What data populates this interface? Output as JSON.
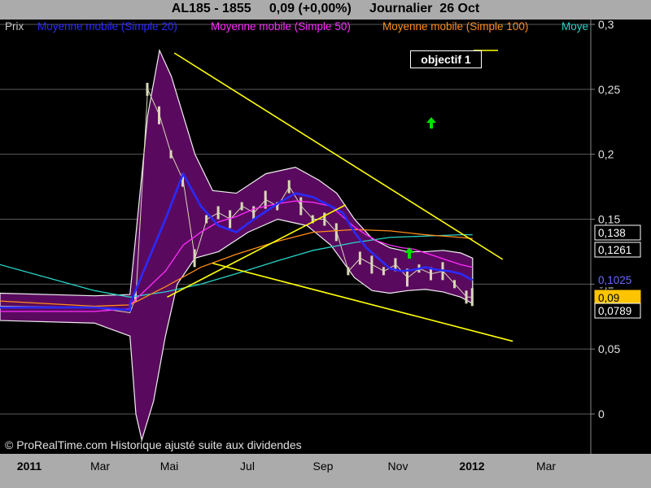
{
  "header": {
    "title": "AL185 - 1855     0,09 (+0,00%)     Journalier  26 Oct"
  },
  "legend": [
    {
      "label": "Prix",
      "color": "#c8c8c8"
    },
    {
      "label": "Moyenne mobile (Simple 20)",
      "color": "#2a2aff"
    },
    {
      "label": "Moyenne mobile (Simple 50)",
      "color": "#ff2dff"
    },
    {
      "label": "Moyenne mobile (Simple 100)",
      "color": "#ff8c1a"
    },
    {
      "label": "Moye",
      "color": "#29d3c8"
    }
  ],
  "annotation": {
    "label": "objectif 1"
  },
  "copyright": "© ProRealTime.com Historique ajusté suite aux dividendes",
  "chart_data": {
    "type": "line",
    "x_tick_labels": [
      "2011",
      "Mar",
      "Mai",
      "Jul",
      "Sep",
      "Nov",
      "2012",
      "Mar"
    ],
    "y_tick_labels": [
      "0,3",
      "0,25",
      "0,2",
      "0,15",
      "0,1",
      "0,05",
      "0"
    ],
    "y_ticks": [
      0.3,
      0.25,
      0.2,
      0.15,
      0.1,
      0.05,
      0
    ],
    "ylim": [
      -0.02,
      0.31
    ],
    "grid": true,
    "price_tags": [
      {
        "label": "0,138",
        "value": 0.138,
        "bg": "#000000",
        "fg": "#ffffff",
        "border": "#ffffff"
      },
      {
        "label": "0,1261",
        "value": 0.1261,
        "bg": "#000000",
        "fg": "#ffffff",
        "border": "#ffffff"
      },
      {
        "label": "0,1025",
        "value": 0.1025,
        "bg": "#000000",
        "fg": "#6a6aff",
        "border": "#000000"
      },
      {
        "label": "0,09",
        "value": 0.09,
        "bg": "#ffc400",
        "fg": "#000000",
        "border": "#ffc400"
      },
      {
        "label": "0,0789",
        "value": 0.0789,
        "bg": "#000000",
        "fg": "#ffffff",
        "border": "#ffffff"
      }
    ],
    "series": [
      {
        "name": "Moyenne mobile (Simple 20)",
        "color": "#2a2aff",
        "points": [
          [
            0,
            0.082
          ],
          [
            0.16,
            0.082
          ],
          [
            0.22,
            0.08
          ],
          [
            0.22,
            0.085
          ],
          [
            0.28,
            0.15
          ],
          [
            0.31,
            0.185
          ],
          [
            0.34,
            0.16
          ],
          [
            0.37,
            0.145
          ],
          [
            0.4,
            0.14
          ],
          [
            0.43,
            0.15
          ],
          [
            0.47,
            0.162
          ],
          [
            0.5,
            0.17
          ],
          [
            0.53,
            0.167
          ],
          [
            0.56,
            0.16
          ],
          [
            0.58,
            0.155
          ],
          [
            0.6,
            0.14
          ],
          [
            0.62,
            0.128
          ],
          [
            0.64,
            0.12
          ],
          [
            0.66,
            0.112
          ],
          [
            0.68,
            0.11
          ],
          [
            0.7,
            0.111
          ],
          [
            0.72,
            0.113
          ],
          [
            0.74,
            0.111
          ],
          [
            0.76,
            0.11
          ],
          [
            0.78,
            0.108
          ],
          [
            0.8,
            0.103
          ]
        ]
      },
      {
        "name": "Moyenne mobile (Simple 50)",
        "color": "#ff2dff",
        "points": [
          [
            0,
            0.079
          ],
          [
            0.16,
            0.079
          ],
          [
            0.22,
            0.081
          ],
          [
            0.22,
            0.084
          ],
          [
            0.28,
            0.11
          ],
          [
            0.31,
            0.13
          ],
          [
            0.34,
            0.14
          ],
          [
            0.37,
            0.148
          ],
          [
            0.4,
            0.152
          ],
          [
            0.43,
            0.158
          ],
          [
            0.47,
            0.162
          ],
          [
            0.5,
            0.164
          ],
          [
            0.53,
            0.163
          ],
          [
            0.56,
            0.16
          ],
          [
            0.58,
            0.152
          ],
          [
            0.6,
            0.144
          ],
          [
            0.62,
            0.138
          ],
          [
            0.64,
            0.133
          ],
          [
            0.66,
            0.13
          ],
          [
            0.68,
            0.128
          ],
          [
            0.7,
            0.127
          ],
          [
            0.72,
            0.124
          ],
          [
            0.74,
            0.121
          ],
          [
            0.76,
            0.118
          ],
          [
            0.78,
            0.115
          ],
          [
            0.8,
            0.113
          ]
        ]
      },
      {
        "name": "Moyenne mobile (Simple 100)",
        "color": "#ff8c1a",
        "points": [
          [
            0,
            0.087
          ],
          [
            0.16,
            0.083
          ],
          [
            0.22,
            0.084
          ],
          [
            0.28,
            0.098
          ],
          [
            0.34,
            0.113
          ],
          [
            0.4,
            0.123
          ],
          [
            0.47,
            0.133
          ],
          [
            0.53,
            0.14
          ],
          [
            0.6,
            0.142
          ],
          [
            0.66,
            0.141
          ],
          [
            0.72,
            0.138
          ],
          [
            0.78,
            0.136
          ],
          [
            0.8,
            0.135
          ]
        ]
      },
      {
        "name": "Moye",
        "color": "#29d3c8",
        "points": [
          [
            0,
            0.115
          ],
          [
            0.08,
            0.105
          ],
          [
            0.16,
            0.095
          ],
          [
            0.22,
            0.09
          ],
          [
            0.28,
            0.094
          ],
          [
            0.34,
            0.1
          ],
          [
            0.4,
            0.108
          ],
          [
            0.47,
            0.118
          ],
          [
            0.53,
            0.126
          ],
          [
            0.6,
            0.132
          ],
          [
            0.66,
            0.136
          ],
          [
            0.72,
            0.137
          ],
          [
            0.78,
            0.138
          ],
          [
            0.8,
            0.138
          ]
        ]
      }
    ],
    "price": {
      "name": "Prix",
      "color": "#d8d8b8",
      "points": [
        [
          0,
          0.083
        ],
        [
          0.16,
          0.082
        ],
        [
          0.22,
          0.078
        ],
        [
          0.23,
          0.09
        ],
        [
          0.25,
          0.25
        ],
        [
          0.27,
          0.23
        ],
        [
          0.29,
          0.2
        ],
        [
          0.31,
          0.18
        ],
        [
          0.33,
          0.12
        ],
        [
          0.35,
          0.15
        ],
        [
          0.37,
          0.155
        ],
        [
          0.39,
          0.15
        ],
        [
          0.41,
          0.16
        ],
        [
          0.43,
          0.155
        ],
        [
          0.45,
          0.165
        ],
        [
          0.47,
          0.16
        ],
        [
          0.49,
          0.175
        ],
        [
          0.51,
          0.16
        ],
        [
          0.53,
          0.15
        ],
        [
          0.55,
          0.15
        ],
        [
          0.57,
          0.14
        ],
        [
          0.59,
          0.11
        ],
        [
          0.61,
          0.12
        ],
        [
          0.63,
          0.115
        ],
        [
          0.65,
          0.11
        ],
        [
          0.67,
          0.115
        ],
        [
          0.69,
          0.105
        ],
        [
          0.71,
          0.112
        ],
        [
          0.73,
          0.108
        ],
        [
          0.75,
          0.11
        ],
        [
          0.77,
          0.1
        ],
        [
          0.79,
          0.09
        ],
        [
          0.8,
          0.09
        ]
      ]
    },
    "envelope": {
      "name": "",
      "color": "#5a0a5e",
      "upper": [
        [
          0,
          0.093
        ],
        [
          0.16,
          0.091
        ],
        [
          0.22,
          0.092
        ],
        [
          0.25,
          0.23
        ],
        [
          0.27,
          0.28
        ],
        [
          0.29,
          0.26
        ],
        [
          0.31,
          0.23
        ],
        [
          0.33,
          0.2
        ],
        [
          0.36,
          0.172
        ],
        [
          0.4,
          0.17
        ],
        [
          0.45,
          0.185
        ],
        [
          0.5,
          0.19
        ],
        [
          0.54,
          0.18
        ],
        [
          0.57,
          0.17
        ],
        [
          0.6,
          0.15
        ],
        [
          0.63,
          0.135
        ],
        [
          0.66,
          0.128
        ],
        [
          0.69,
          0.125
        ],
        [
          0.72,
          0.125
        ],
        [
          0.75,
          0.126
        ],
        [
          0.78,
          0.124
        ],
        [
          0.8,
          0.12
        ]
      ],
      "lower": [
        [
          0,
          0.072
        ],
        [
          0.16,
          0.07
        ],
        [
          0.22,
          0.06
        ],
        [
          0.23,
          0.0
        ],
        [
          0.24,
          -0.02
        ],
        [
          0.26,
          0.01
        ],
        [
          0.28,
          0.06
        ],
        [
          0.3,
          0.1
        ],
        [
          0.33,
          0.12
        ],
        [
          0.37,
          0.125
        ],
        [
          0.42,
          0.14
        ],
        [
          0.47,
          0.15
        ],
        [
          0.52,
          0.145
        ],
        [
          0.56,
          0.13
        ],
        [
          0.6,
          0.105
        ],
        [
          0.63,
          0.095
        ],
        [
          0.66,
          0.093
        ],
        [
          0.69,
          0.095
        ],
        [
          0.72,
          0.096
        ],
        [
          0.75,
          0.094
        ],
        [
          0.78,
          0.09
        ],
        [
          0.8,
          0.085
        ]
      ]
    },
    "trend_lines": [
      {
        "color": "#ffff00",
        "from": [
          0.295,
          0.278
        ],
        "to": [
          0.851,
          0.119
        ]
      },
      {
        "color": "#ffff00",
        "from": [
          0.36,
          0.116
        ],
        "to": [
          0.868,
          0.056
        ]
      },
      {
        "color": "#ffff00",
        "from": [
          0.283,
          0.09
        ],
        "to": [
          0.585,
          0.161
        ]
      }
    ]
  }
}
